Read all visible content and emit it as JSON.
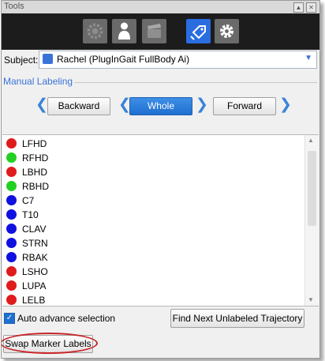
{
  "window": {
    "title": "Tools",
    "pin_icon": "pin-icon",
    "close_icon": "close-icon"
  },
  "toolbar": {
    "buttons": [
      {
        "name": "settings-gear-grey-icon",
        "active": false
      },
      {
        "name": "person-icon",
        "active": false
      },
      {
        "name": "clapperboard-icon",
        "active": false
      },
      {
        "name": "label-tag-icon",
        "active": true
      },
      {
        "name": "gear-icon",
        "active": false
      }
    ]
  },
  "subject": {
    "label": "Subject:",
    "value": "Rachel (PlugInGait FullBody Ai)"
  },
  "manual_labeling": {
    "label": "Manual Labeling",
    "backward_label": "Backward",
    "whole_label": "Whole",
    "forward_label": "Forward"
  },
  "markers": [
    {
      "name": "LFHD",
      "color": "#e01b1b"
    },
    {
      "name": "RFHD",
      "color": "#22d022"
    },
    {
      "name": "LBHD",
      "color": "#e01b1b"
    },
    {
      "name": "RBHD",
      "color": "#22d022"
    },
    {
      "name": "C7",
      "color": "#1010e0"
    },
    {
      "name": "T10",
      "color": "#1010e0"
    },
    {
      "name": "CLAV",
      "color": "#1010e0"
    },
    {
      "name": "STRN",
      "color": "#1010e0"
    },
    {
      "name": "RBAK",
      "color": "#1010e0"
    },
    {
      "name": "LSHO",
      "color": "#e01b1b"
    },
    {
      "name": "LUPA",
      "color": "#e01b1b"
    },
    {
      "name": "LELB",
      "color": "#e01b1b"
    }
  ],
  "auto_advance": {
    "label": "Auto advance selection",
    "checked": true
  },
  "find_next_label": "Find Next Unlabeled Trajectory",
  "swap_label": "Swap Marker Labels"
}
